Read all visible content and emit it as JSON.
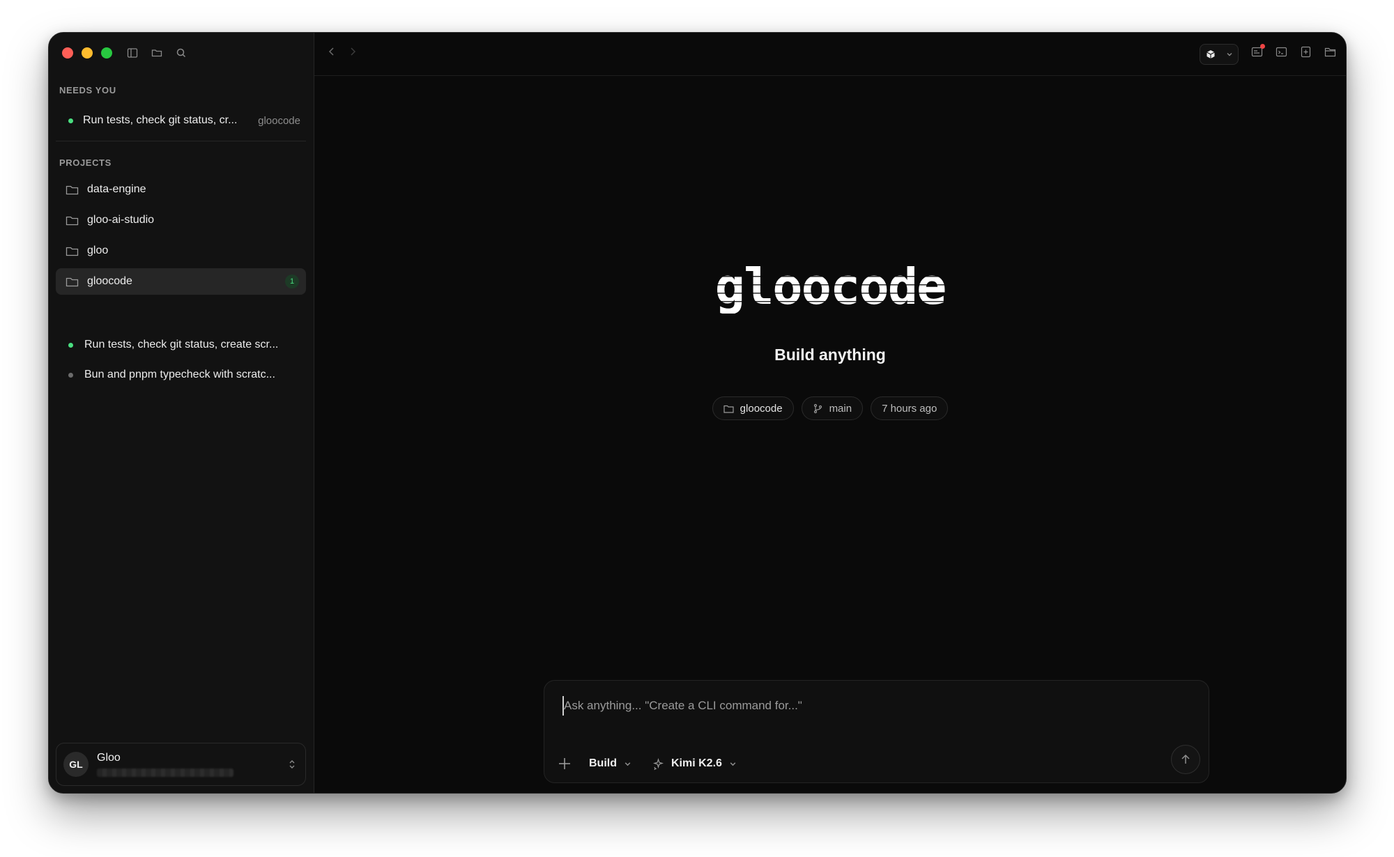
{
  "window": {
    "traffic_lights": [
      "close",
      "minimize",
      "zoom"
    ]
  },
  "sidebar": {
    "toolbar_icons": [
      "sidebar-toggle-icon",
      "folder-icon",
      "search-icon"
    ],
    "needs_you": {
      "heading": "NEEDS YOU",
      "item": {
        "label": "Run tests, check git status, cr...",
        "project": "gloocode",
        "status_color": "#4ade80"
      }
    },
    "projects": {
      "heading": "PROJECTS",
      "items": [
        {
          "label": "data-engine"
        },
        {
          "label": "gloo-ai-studio"
        },
        {
          "label": "gloo"
        },
        {
          "label": "gloocode",
          "badge": "1",
          "active": true
        }
      ],
      "sessions": [
        {
          "label": "Run tests, check git status, create scr...",
          "status_color": "#4ade80"
        },
        {
          "label": "Bun and pnpm typecheck with scratc...",
          "status_color": "#6b6b6b"
        }
      ]
    },
    "user": {
      "initials": "GL",
      "name": "Gloo"
    }
  },
  "main": {
    "logo_text": "gloocode",
    "tagline": "Build anything",
    "chips": {
      "project": "gloocode",
      "branch": "main",
      "updated": "7 hours ago"
    },
    "composer": {
      "placeholder": "Ask anything... \"Create a CLI command for...\"",
      "value": "",
      "mode": "Build",
      "model": "Kimi K2.6"
    }
  },
  "colors": {
    "background": "#0a0a0a",
    "sidebar": "#121212",
    "accent_green": "#4ade80",
    "notification": "#ef4444"
  }
}
